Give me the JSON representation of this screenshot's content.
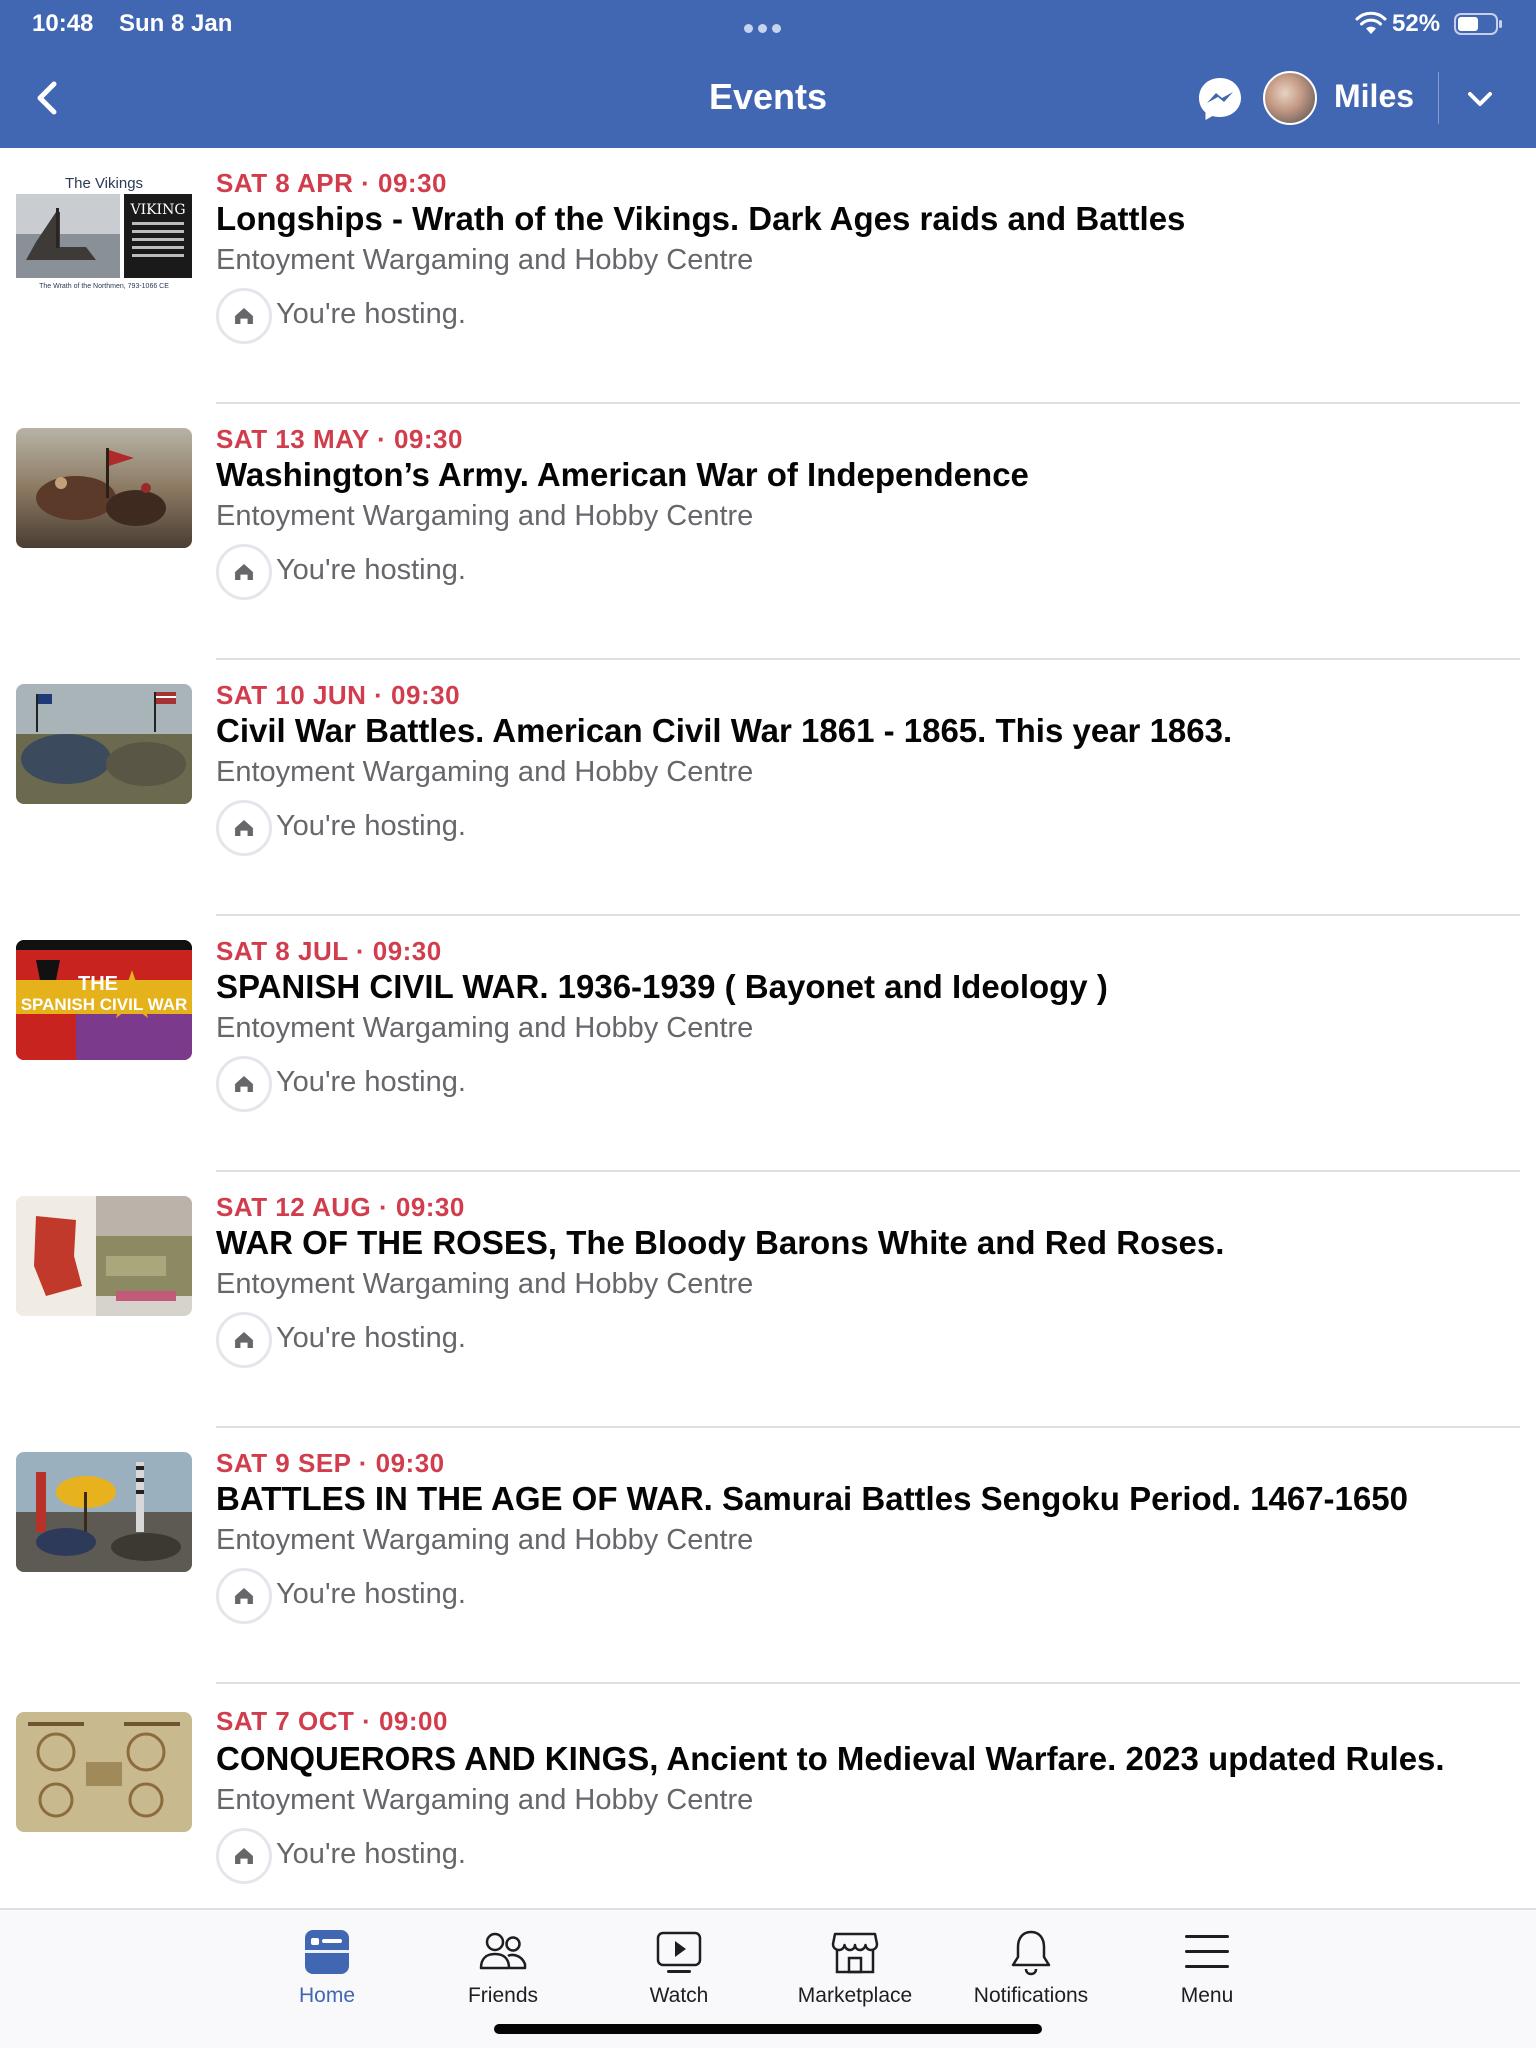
{
  "status_bar": {
    "time": "10:48",
    "date": "Sun 8 Jan",
    "battery": "52%"
  },
  "header": {
    "title": "Events",
    "user_name": "Miles"
  },
  "events": [
    {
      "date": "SAT 8 APR · 09:30",
      "title": "Longships - Wrath of the Vikings. Dark Ages raids and Battles",
      "venue": "Entoyment Wargaming and Hobby Centre",
      "host_status": "You're hosting.",
      "thumb": {
        "caption_top": "The Vikings",
        "caption_side": "VIKING",
        "caption_bottom": "The Wrath of the Northmen, 793-1066 CE"
      }
    },
    {
      "date": "SAT 13 MAY · 09:30",
      "title": "Washington’s Army. American War of Independence",
      "venue": "Entoyment Wargaming and Hobby Centre",
      "host_status": "You're hosting."
    },
    {
      "date": "SAT 10 JUN · 09:30",
      "title": "Civil War Battles. American Civil War 1861 - 1865. This year 1863.",
      "venue": "Entoyment Wargaming and Hobby Centre",
      "host_status": "You're hosting."
    },
    {
      "date": "SAT 8 JUL · 09:30",
      "title": "SPANISH CIVIL WAR. 1936-1939 ( Bayonet and Ideology )",
      "venue": "Entoyment Wargaming and Hobby Centre",
      "host_status": "You're hosting.",
      "thumb": {
        "line1": "THE",
        "line2": "SPANISH CIVIL WAR"
      }
    },
    {
      "date": "SAT 12 AUG · 09:30",
      "title": "WAR OF THE ROSES, The Bloody Barons White and Red Roses.",
      "venue": "Entoyment Wargaming and Hobby Centre",
      "host_status": "You're hosting."
    },
    {
      "date": "SAT 9 SEP · 09:30",
      "title": "BATTLES IN THE AGE OF WAR. Samurai Battles Sengoku Period. 1467-1650",
      "venue": "Entoyment Wargaming and Hobby Centre",
      "host_status": "You're hosting."
    },
    {
      "date": "SAT 7 OCT · 09:00",
      "title": "CONQUERORS AND KINGS, Ancient to Medieval Warfare. 2023 updated Rules.",
      "venue": "Entoyment Wargaming and Hobby Centre",
      "host_status": "You're hosting."
    }
  ],
  "tabs": [
    {
      "label": "Home",
      "icon": "home-icon",
      "active": true
    },
    {
      "label": "Friends",
      "icon": "friends-icon"
    },
    {
      "label": "Watch",
      "icon": "watch-icon"
    },
    {
      "label": "Marketplace",
      "icon": "marketplace-icon"
    },
    {
      "label": "Notifications",
      "icon": "bell-icon"
    },
    {
      "label": "Menu",
      "icon": "menu-icon"
    }
  ],
  "colors": {
    "header_bg": "#4267b2",
    "event_date": "#d13d4d",
    "active_tab": "#4267b2"
  }
}
